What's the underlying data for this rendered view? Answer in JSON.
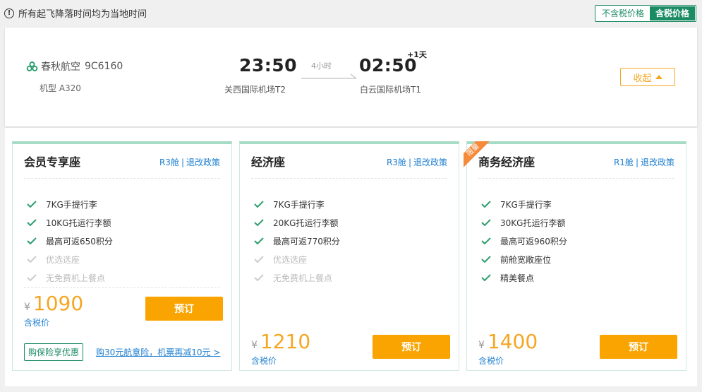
{
  "notice": {
    "icon": "info-icon",
    "text": "所有起飞降落时间均为当地时间"
  },
  "price_toggle": {
    "exclude_tax": "不含税价格",
    "include_tax": "含税价格",
    "selected": "含税价格"
  },
  "flight": {
    "airline": "春秋航空",
    "flight_no": "9C6160",
    "aircraft": "机型 A320",
    "departure_time": "23:50",
    "departure_airport": "关西国际机场T2",
    "duration": "4小时",
    "arrival_time": "02:50",
    "next_day": "+1天",
    "arrival_airport": "白云国际机场T1",
    "collapse_label": "收起"
  },
  "cabins": [
    {
      "title": "会员专享座",
      "class_code": "R3舱",
      "policy": "退改政策",
      "features": [
        {
          "text": "7KG手提行李",
          "enabled": true
        },
        {
          "text": "10KG托运行李额",
          "enabled": true
        },
        {
          "text": "最高可返650积分",
          "enabled": true
        },
        {
          "text": "优选选座",
          "enabled": false
        },
        {
          "text": "无免费机上餐点",
          "enabled": false
        }
      ],
      "currency": "¥",
      "price": "1090",
      "tax_label": "含税价",
      "book_label": "预订",
      "insurance_tag": "购保险享优惠",
      "insurance_link": "购30元航意险，机票再减10元 >"
    },
    {
      "title": "经济座",
      "class_code": "R3舱",
      "policy": "退改政策",
      "features": [
        {
          "text": "7KG手提行李",
          "enabled": true
        },
        {
          "text": "20KG托运行李额",
          "enabled": true
        },
        {
          "text": "最高可返770积分",
          "enabled": true
        },
        {
          "text": "优选选座",
          "enabled": false
        },
        {
          "text": "无免费机上餐点",
          "enabled": false
        }
      ],
      "currency": "¥",
      "price": "1210",
      "tax_label": "含税价",
      "book_label": "预订"
    },
    {
      "title": "商务经济座",
      "badge": "限量",
      "class_code": "R1舱",
      "policy": "退改政策",
      "features": [
        {
          "text": "7KG手提行李",
          "enabled": true
        },
        {
          "text": "30KG托运行李额",
          "enabled": true
        },
        {
          "text": "最高可返960积分",
          "enabled": true
        },
        {
          "text": "前舱宽敞座位",
          "enabled": true
        },
        {
          "text": "精美餐点",
          "enabled": true
        }
      ],
      "currency": "¥",
      "price": "1400",
      "tax_label": "含税价",
      "book_label": "预订"
    }
  ],
  "colors": {
    "brand_green": "#1b8b64",
    "accent_orange": "#f9a400",
    "link_blue": "#1e7fd0",
    "check_green": "#2e9e6e"
  }
}
